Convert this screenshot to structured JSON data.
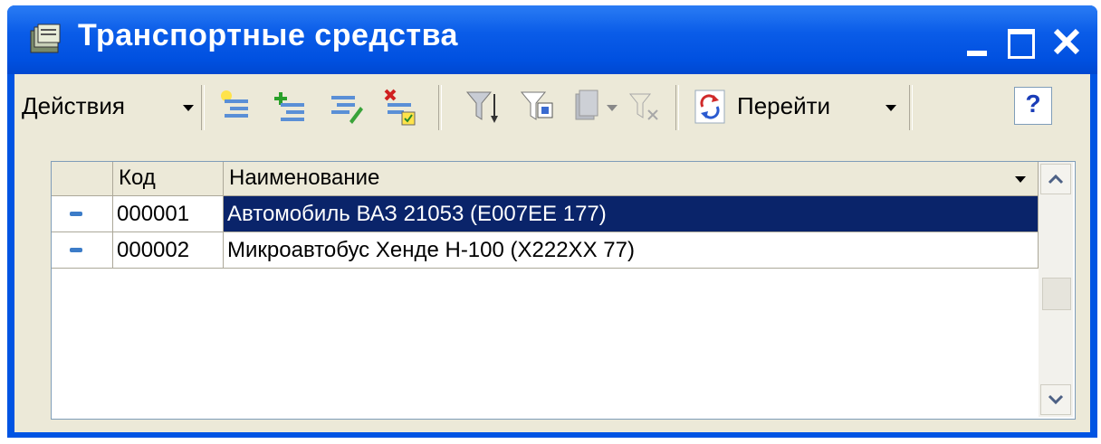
{
  "window": {
    "title": "Транспортные средства"
  },
  "toolbar": {
    "actions_label": "Действия",
    "goto_label": "Перейти",
    "help_label": "?"
  },
  "grid": {
    "columns": [
      "Код",
      "Наименование"
    ],
    "rows": [
      {
        "code": "000001",
        "name": "Автомобиль ВАЗ 21053 (Е007ЕЕ 177)",
        "selected": true
      },
      {
        "code": "000002",
        "name": "Микроавтобус Хенде Н-100 (Х222ХХ 77)",
        "selected": false
      }
    ]
  },
  "colors": {
    "title_bar": "#0054e3",
    "selection": "#0a246a",
    "panel": "#ece9d8"
  }
}
